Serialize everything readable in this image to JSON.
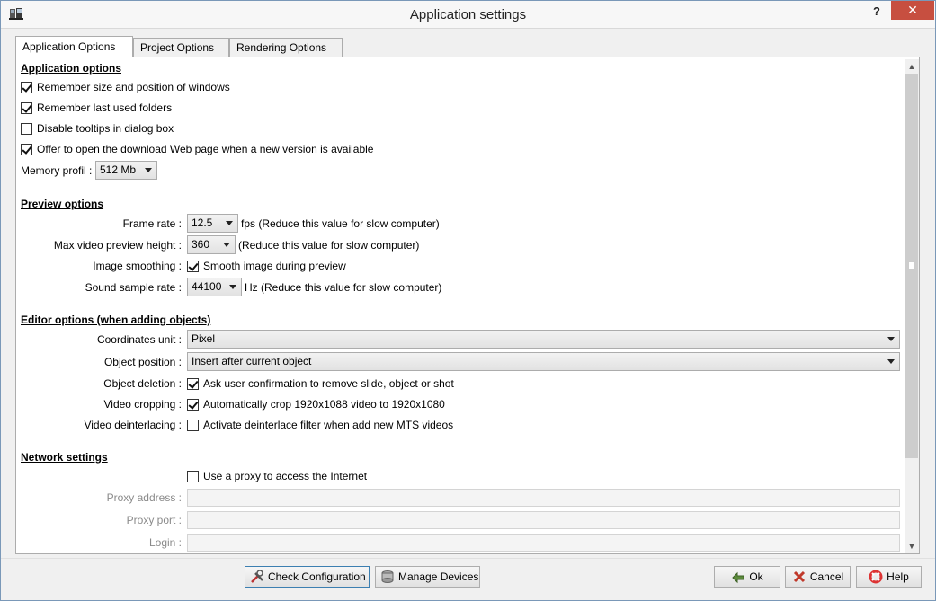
{
  "window": {
    "title": "Application settings",
    "help_glyph": "?",
    "close_glyph": "✕"
  },
  "tabs": [
    {
      "label": "Application Options",
      "active": true
    },
    {
      "label": "Project Options",
      "active": false
    },
    {
      "label": "Rendering Options",
      "active": false
    }
  ],
  "application_options": {
    "heading": "Application options",
    "remember_size": {
      "label": "Remember size and position of windows",
      "checked": true
    },
    "remember_folders": {
      "label": "Remember last used folders",
      "checked": true
    },
    "disable_tooltips": {
      "label": "Disable tooltips in dialog box",
      "checked": false
    },
    "offer_download": {
      "label": "Offer to open the download Web page when a new version is available",
      "checked": true
    },
    "memory_profil_label": "Memory profil :",
    "memory_profil_value": "512 Mb"
  },
  "preview_options": {
    "heading": "Preview options",
    "frame_rate_label": "Frame rate :",
    "frame_rate_value": "12.5",
    "frame_rate_hint": "fps (Reduce this value for slow computer)",
    "max_height_label": "Max video preview height :",
    "max_height_value": "360",
    "max_height_hint": "(Reduce this value for slow computer)",
    "smoothing_label": "Image smoothing :",
    "smoothing": {
      "label": "Smooth image during preview",
      "checked": true
    },
    "sound_rate_label": "Sound sample rate :",
    "sound_rate_value": "44100",
    "sound_rate_hint": "Hz (Reduce this value for slow computer)"
  },
  "editor_options": {
    "heading": "Editor options (when adding objects)",
    "coordinates_label": "Coordinates unit :",
    "coordinates_value": "Pixel",
    "position_label": "Object position :",
    "position_value": "Insert after current object",
    "deletion_label": "Object deletion :",
    "deletion": {
      "label": "Ask user confirmation to remove slide, object or shot",
      "checked": true
    },
    "cropping_label": "Video cropping :",
    "cropping": {
      "label": "Automatically crop 1920x1088 video to 1920x1080",
      "checked": true
    },
    "deinterlacing_label": "Video deinterlacing :",
    "deinterlacing": {
      "label": "Activate deinterlace filter when add new MTS videos",
      "checked": false
    }
  },
  "network_settings": {
    "heading": "Network settings",
    "use_proxy": {
      "label": "Use a proxy to access the Internet",
      "checked": false
    },
    "proxy_address_label": "Proxy address :",
    "proxy_address_value": "",
    "proxy_port_label": "Proxy port :",
    "proxy_port_value": "",
    "login_label": "Login :",
    "login_value": ""
  },
  "footer": {
    "check_configuration": "Check Configuration",
    "manage_devices": "Manage Devices",
    "ok": "Ok",
    "cancel": "Cancel",
    "help": "Help"
  },
  "colors": {
    "close_button": "#c74f40",
    "focus_border": "#3c7fb1",
    "disabled_text": "#8a8a8a"
  }
}
